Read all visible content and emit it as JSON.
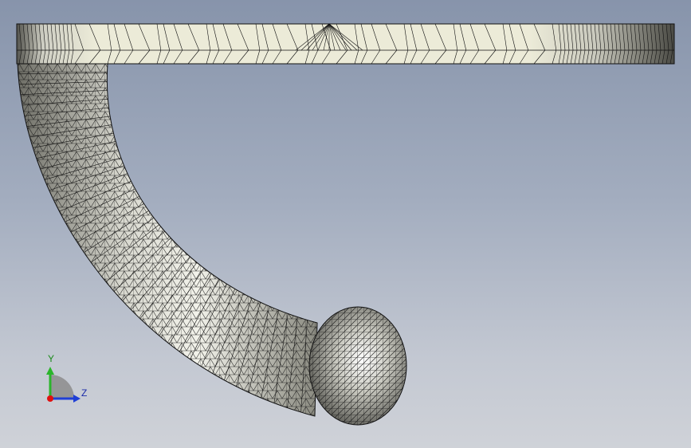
{
  "viewport": {
    "background_top": "#8794ab",
    "background_bottom": "#cfd2d8",
    "mesh_fill": "#e8e8df",
    "mesh_line": "#1a1a1a"
  },
  "model": {
    "parts": [
      "plate-icon",
      "curved-arm-icon",
      "ball-end-icon"
    ]
  },
  "triad": {
    "y_label": "Y",
    "z_label": "Z",
    "y_color": "#2bb52b",
    "z_color": "#1f3fd6",
    "x_color": "#e01010",
    "icon": "axis-triad-icon"
  }
}
